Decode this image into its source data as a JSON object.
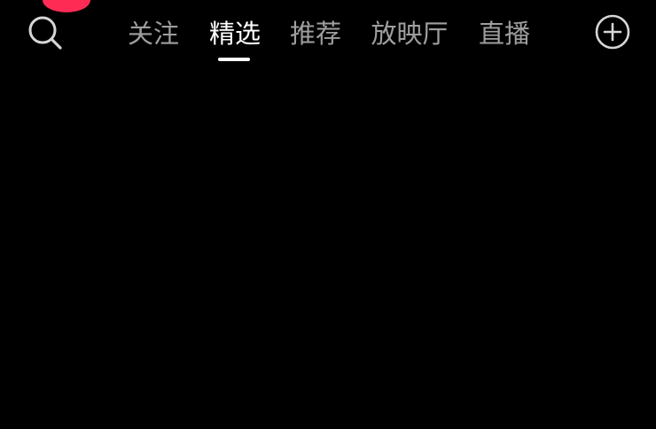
{
  "header": {
    "search_icon": "search-icon",
    "add_icon": "plus-circle-icon",
    "tabs": [
      {
        "label": "关注",
        "active": false
      },
      {
        "label": "精选",
        "active": true
      },
      {
        "label": "推荐",
        "active": false
      },
      {
        "label": "放映厅",
        "active": false
      },
      {
        "label": "直播",
        "active": false
      }
    ]
  },
  "colors": {
    "background": "#000000",
    "notification": "#fe2c55",
    "tab_active": "#ffffff",
    "tab_inactive": "#9e9e9e"
  }
}
